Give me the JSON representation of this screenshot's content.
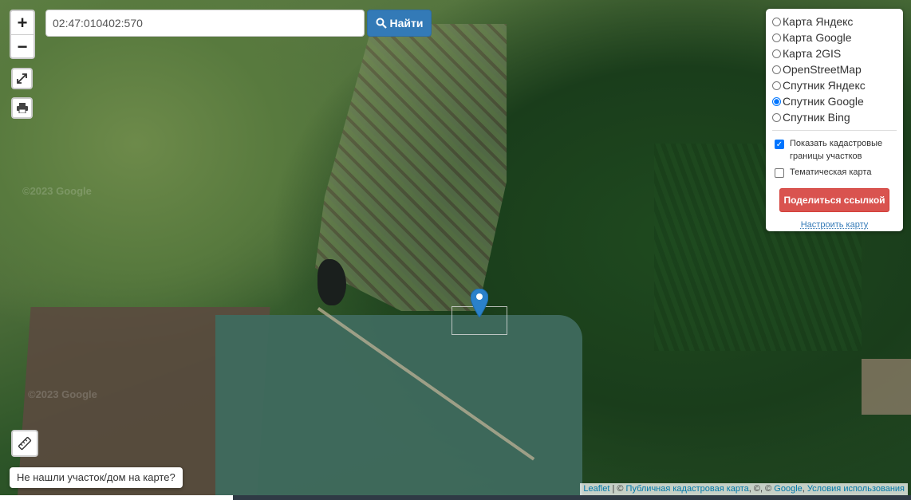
{
  "search": {
    "value": "02:47:010402:570",
    "button_label": "Найти"
  },
  "zoom": {
    "in_label": "+",
    "out_label": "−"
  },
  "layers": {
    "options": [
      {
        "label": "Карта Яндекс",
        "selected": false
      },
      {
        "label": "Карта Google",
        "selected": false
      },
      {
        "label": "Карта 2GIS",
        "selected": false
      },
      {
        "label": "OpenStreetMap",
        "selected": false
      },
      {
        "label": "Спутник Яндекс",
        "selected": false
      },
      {
        "label": "Спутник Google",
        "selected": true
      },
      {
        "label": "Спутник Bing",
        "selected": false
      }
    ],
    "cadastral_checkbox": {
      "label": "Показать кадастровые границы участков",
      "checked": true
    },
    "thematic_checkbox": {
      "label": "Тематическая карта",
      "checked": false
    },
    "share_button": "Поделиться ссылкой",
    "configure_link": "Настроить карту"
  },
  "not_found_button": "Не нашли участок/дом на карте?",
  "attribution": {
    "leaflet": "Leaflet",
    "sep1": " | © ",
    "cadastre": "Публичная кадастровая карта",
    "sep2": ", ©, © ",
    "google": "Google",
    "sep3": ", ",
    "terms": "Условия использования"
  },
  "watermarks": [
    "©2023 Google",
    "©2023 Google"
  ],
  "colors": {
    "primary": "#337ab7",
    "danger": "#d9534f",
    "marker": "#2a81cb"
  },
  "icons": {
    "fullscreen": "expand-icon",
    "print": "printer-icon",
    "ruler": "ruler-icon",
    "search": "search-icon",
    "marker": "map-marker-icon"
  }
}
